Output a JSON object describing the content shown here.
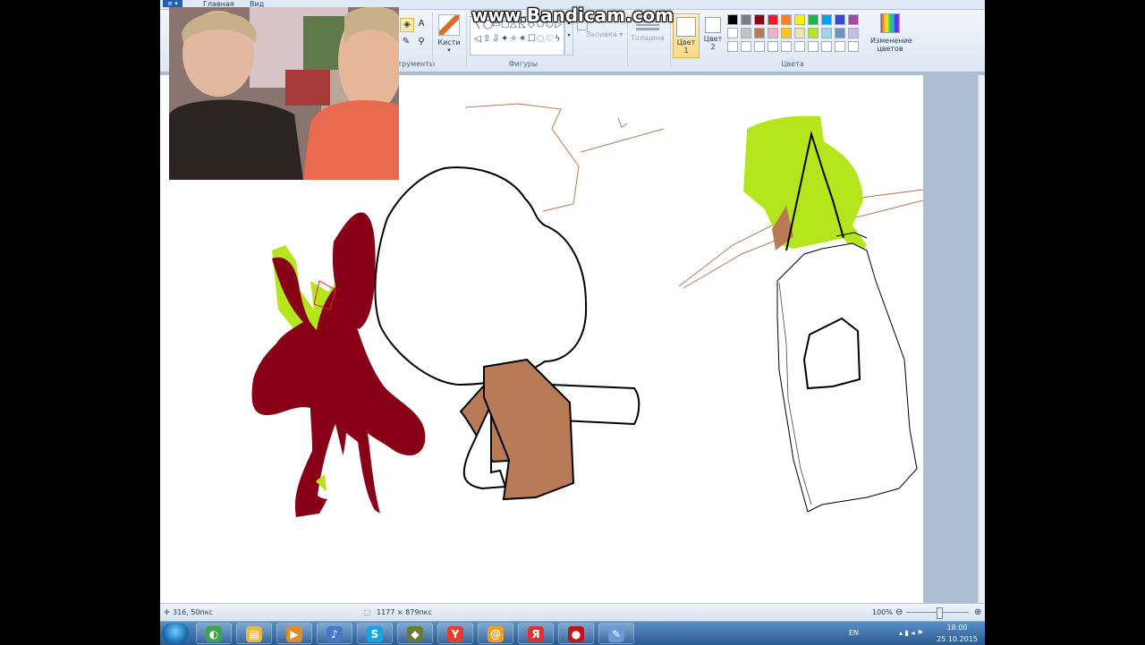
{
  "ribbon": {
    "app_menu": "≡ ▾",
    "tabs": [
      "Главная",
      "Вид"
    ],
    "brushes_label": "Кисти",
    "fill_label": "Заливка",
    "fill_arrow": "▾",
    "thickness_label": "Толщина",
    "groups": {
      "tools": "Инструменты",
      "shapes": "Фигуры",
      "colors": "Цвета"
    },
    "color1": {
      "line1": "Цвет",
      "line2": "1"
    },
    "color2": {
      "line1": "Цвет",
      "line2": "2"
    },
    "edit_colors": {
      "line1": "Изменение",
      "line2": "цветов"
    },
    "palette_row1": [
      "#000000",
      "#7f7f7f",
      "#880015",
      "#ed1c24",
      "#ff7f27",
      "#fff200",
      "#22b14c",
      "#00a2e8",
      "#3f48cc",
      "#a349a4"
    ],
    "palette_row2": [
      "#ffffff",
      "#c3c3c3",
      "#b97a57",
      "#ffaec9",
      "#ffc90e",
      "#efe4b0",
      "#b5e61d",
      "#99d9ea",
      "#7092be",
      "#c8bfe7"
    ]
  },
  "icons": {
    "text_tool": "A",
    "picker_tool": "✎",
    "magnifier_tool": "⚲",
    "shapes_row1": [
      "╲",
      "◯",
      "▭",
      "▢",
      "△",
      "◺",
      "◇",
      "⬠",
      "⬡",
      "▷"
    ],
    "shapes_row2": [
      "◁",
      "⇧",
      "⇩",
      "✦",
      "✧",
      "✶",
      "☐",
      "◌",
      "♡",
      "ϟ"
    ]
  },
  "status": {
    "cursor_pos": "316, 50пкс",
    "image_size": "1177 × 879пкс",
    "zoom": "100%",
    "zoom_minus": "⊖",
    "zoom_plus": "⊕"
  },
  "watermark": "www.Bandicam.com",
  "taskbar": {
    "language": "EN",
    "time": "18:00",
    "date": "25.10.2015",
    "apps": [
      {
        "name": "chrome",
        "color": "#3aa54a",
        "glyph": "◐"
      },
      {
        "name": "explorer",
        "color": "#e8b84a",
        "glyph": "▤"
      },
      {
        "name": "media-player",
        "color": "#e08a2a",
        "glyph": "▶"
      },
      {
        "name": "audio",
        "color": "#4a78c8",
        "glyph": "♪"
      },
      {
        "name": "skype",
        "color": "#11a7e3",
        "glyph": "S"
      },
      {
        "name": "shield",
        "color": "#6b7a38",
        "glyph": "◆"
      },
      {
        "name": "yandex-browser",
        "color": "#e83a2e",
        "glyph": "Y"
      },
      {
        "name": "mail-agent",
        "color": "#f0a020",
        "glyph": "@"
      },
      {
        "name": "yandex",
        "color": "#e03030",
        "glyph": "Я"
      },
      {
        "name": "bandicam",
        "color": "#c01515",
        "glyph": "●"
      },
      {
        "name": "paint",
        "color": "#6a9bd8",
        "glyph": "✎"
      }
    ]
  }
}
